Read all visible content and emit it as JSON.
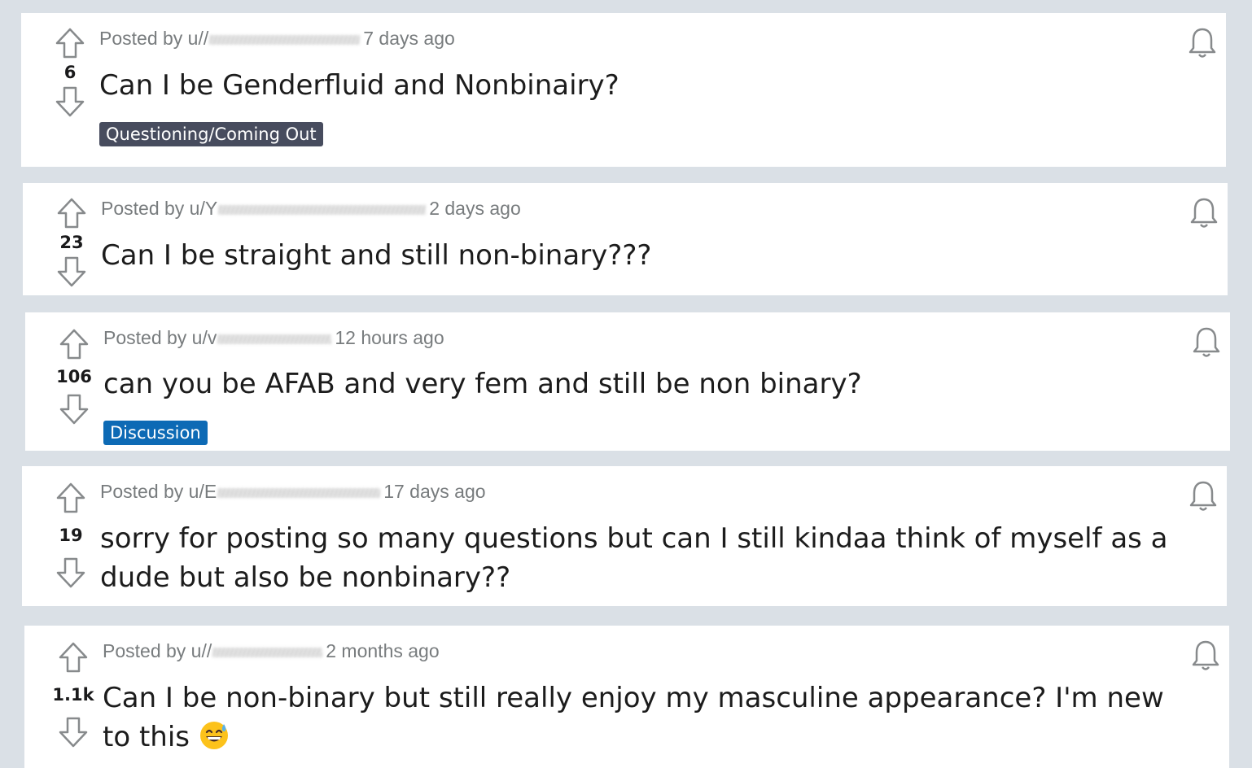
{
  "posts": [
    {
      "score": "6",
      "posted_by": "Posted by u/",
      "username": "/",
      "time": "7 days ago",
      "title": "Can I be Genderfluid and Nonbinairy?",
      "flair": "Questioning/Coming Out",
      "flair_color": "#474c5e"
    },
    {
      "score": "23",
      "posted_by": "Posted by u/",
      "username": "Y",
      "time": "2 days ago",
      "title": "Can I be straight and still non-binary???"
    },
    {
      "score": "106",
      "posted_by": "Posted by u/",
      "username": "v",
      "time": "12 hours ago",
      "title": "can you be AFAB and very fem and still be non binary?",
      "flair": "Discussion",
      "flair_color": "#0d6ab5"
    },
    {
      "score": "19",
      "posted_by": "Posted by u/",
      "username": "E",
      "time": "17 days ago",
      "title": "sorry for posting so many questions but can I still kindaa think of myself as a dude but also be nonbinary??"
    },
    {
      "score": "1.1k",
      "posted_by": "Posted by u/",
      "username": "/",
      "time": "2 months ago",
      "title": "Can I be non-binary but still really enjoy my masculine appearance? I'm new to this",
      "emoji": "grinning-sweat-emoji"
    }
  ],
  "colors": {
    "page_background": "#dae0e6",
    "card_background": "#ffffff",
    "meta_text": "#787c7e",
    "title_text": "#1c1c1c"
  }
}
